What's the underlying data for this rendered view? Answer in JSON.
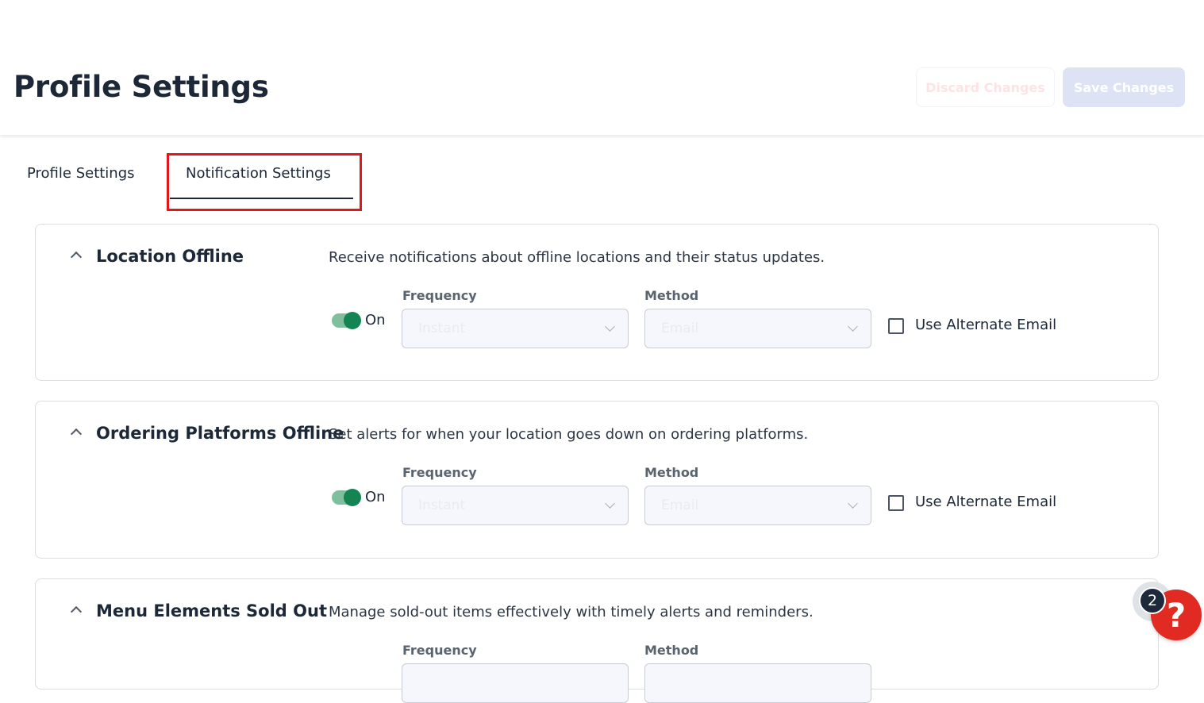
{
  "header": {
    "title": "Profile Settings",
    "discard_label": "Discard Changes",
    "save_label": "Save Changes"
  },
  "tabs": [
    {
      "label": "Profile Settings",
      "active": false
    },
    {
      "label": "Notification Settings",
      "active": true
    }
  ],
  "cards": [
    {
      "title": "Location Offline",
      "description": "Receive notifications about offline locations and their status updates.",
      "toggle_label": "On",
      "toggle_on": true,
      "frequency_label": "Frequency",
      "frequency_value": "Instant",
      "method_label": "Method",
      "method_value": "Email",
      "checkbox_label": "Use Alternate Email",
      "checkbox_checked": false
    },
    {
      "title": "Ordering Platforms Offline",
      "description": "Set alerts for when your location goes down on ordering platforms.",
      "toggle_label": "On",
      "toggle_on": true,
      "frequency_label": "Frequency",
      "frequency_value": "Instant",
      "method_label": "Method",
      "method_value": "Email",
      "checkbox_label": "Use Alternate Email",
      "checkbox_checked": false
    },
    {
      "title": "Menu Elements Sold Out",
      "description": "Manage sold-out items effectively with timely alerts and reminders.",
      "frequency_label": "Frequency",
      "method_label": "Method"
    }
  ],
  "help": {
    "badge_count": "2",
    "icon_glyph": "?"
  },
  "colors": {
    "accent_green": "#138452",
    "highlight_red": "#e3171b",
    "help_red": "#e02a22",
    "title_dark": "#1c2738"
  }
}
